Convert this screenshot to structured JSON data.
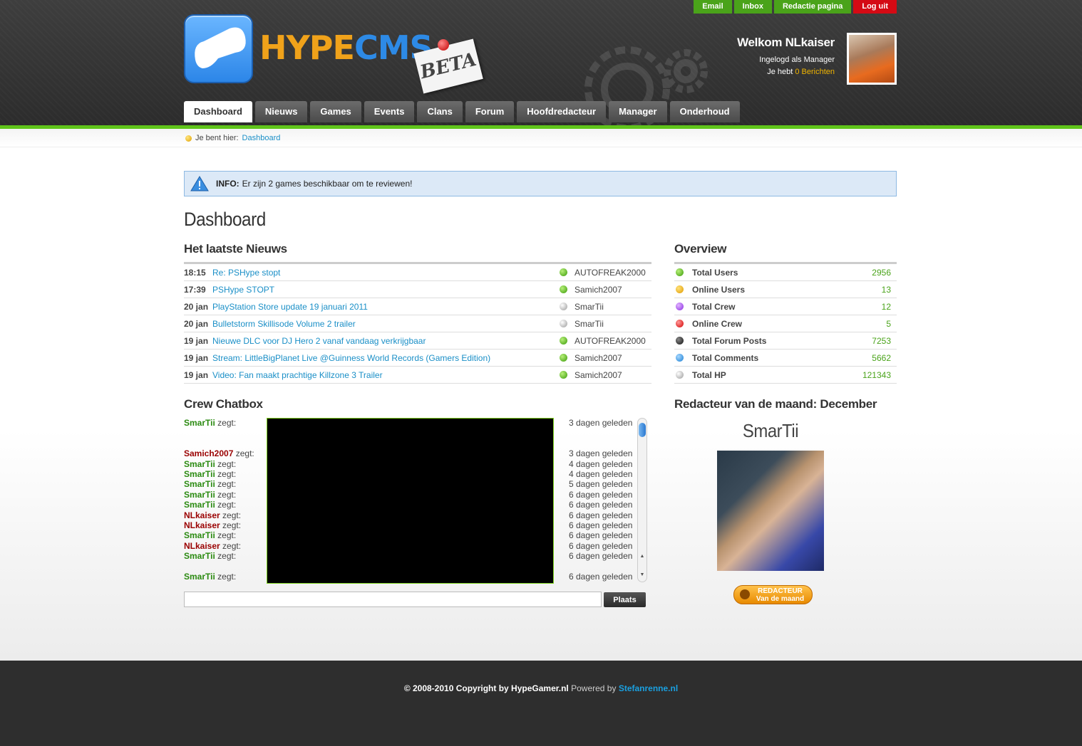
{
  "top_links": [
    "Email",
    "Inbox",
    "Redactie pagina",
    "Log uit"
  ],
  "logo": {
    "hype": "HYPE",
    "cms": "CMS",
    "beta": "BETA"
  },
  "user": {
    "welcome": "Welkom NLkaiser",
    "role": "Ingelogd als Manager",
    "messages_prefix": "Je hebt",
    "messages_count": "0 Berichten"
  },
  "main_nav": [
    "Dashboard",
    "Nieuws",
    "Games",
    "Events",
    "Clans",
    "Forum",
    "Hoofdredacteur",
    "Manager",
    "Onderhoud"
  ],
  "breadcrumb": {
    "prefix": "Je bent hier:",
    "current": "Dashboard"
  },
  "info": {
    "label": "INFO:",
    "text": "Er zijn 2 games beschikbaar om te reviewen!"
  },
  "page_title": "Dashboard",
  "news": {
    "title": "Het laatste Nieuws",
    "items": [
      {
        "time": "18:15",
        "title": "Re: PSHype stopt",
        "status": "green",
        "author": "AUTOFREAK2000"
      },
      {
        "time": "17:39",
        "title": "PSHype STOPT",
        "status": "green",
        "author": "Samich2007"
      },
      {
        "time": "20 jan",
        "title": "PlayStation Store update 19 januari 2011",
        "status": "gray",
        "author": "SmarTii"
      },
      {
        "time": "20 jan",
        "title": "Bulletstorm Skillisode Volume 2 trailer",
        "status": "gray",
        "author": "SmarTii"
      },
      {
        "time": "19 jan",
        "title": "Nieuwe DLC voor DJ Hero 2 vanaf vandaag verkrijgbaar",
        "status": "green",
        "author": "AUTOFREAK2000"
      },
      {
        "time": "19 jan",
        "title": "Stream: LittleBigPlanet Live @Guinness World Records (Gamers Edition)",
        "status": "green",
        "author": "Samich2007"
      },
      {
        "time": "19 jan",
        "title": "Video: Fan maakt prachtige Killzone 3 Trailer",
        "status": "green",
        "author": "Samich2007"
      }
    ]
  },
  "overview": {
    "title": "Overview",
    "items": [
      {
        "label": "Total Users",
        "value": "2956",
        "color": "green"
      },
      {
        "label": "Online Users",
        "value": "13",
        "color": "orange"
      },
      {
        "label": "Total Crew",
        "value": "12",
        "color": "purple"
      },
      {
        "label": "Online Crew",
        "value": "5",
        "color": "red"
      },
      {
        "label": "Total Forum Posts",
        "value": "7253",
        "color": "black"
      },
      {
        "label": "Total Comments",
        "value": "5662",
        "color": "blue"
      },
      {
        "label": "Total HP",
        "value": "121343",
        "color": "gray"
      }
    ]
  },
  "chatbox": {
    "title": "Crew Chatbox",
    "says": "zegt:",
    "messages": [
      {
        "name": "SmarTii",
        "color": "g",
        "time": "3 dagen geleden"
      },
      {
        "name": "Samich2007",
        "color": "r",
        "time": "3 dagen geleden"
      },
      {
        "name": "SmarTii",
        "color": "g",
        "time": "4 dagen geleden"
      },
      {
        "name": "SmarTii",
        "color": "g",
        "time": "4 dagen geleden"
      },
      {
        "name": "SmarTii",
        "color": "g",
        "time": "5 dagen geleden"
      },
      {
        "name": "SmarTii",
        "color": "g",
        "time": "6 dagen geleden"
      },
      {
        "name": "SmarTii",
        "color": "g",
        "time": "6 dagen geleden"
      },
      {
        "name": "NLkaiser",
        "color": "r",
        "time": "6 dagen geleden"
      },
      {
        "name": "NLkaiser",
        "color": "r",
        "time": "6 dagen geleden"
      },
      {
        "name": "SmarTii",
        "color": "g",
        "time": "6 dagen geleden"
      },
      {
        "name": "NLkaiser",
        "color": "r",
        "time": "6 dagen geleden"
      },
      {
        "name": "SmarTii",
        "color": "g",
        "time": "6 dagen geleden"
      },
      {
        "name": "SmarTii",
        "color": "g",
        "time": "6 dagen geleden"
      }
    ],
    "input_value": "",
    "submit_label": "Plaats"
  },
  "redacteur": {
    "title": "Redacteur van de maand: December",
    "name": "SmarTii",
    "badge_line1": "REDACTEUR",
    "badge_line2": "Van de maand"
  },
  "footer": {
    "copyright": "© 2008-2010 Copyright by HypeGamer.nl",
    "powered": "Powered by",
    "powered_link": "Stefanrenne.nl"
  }
}
